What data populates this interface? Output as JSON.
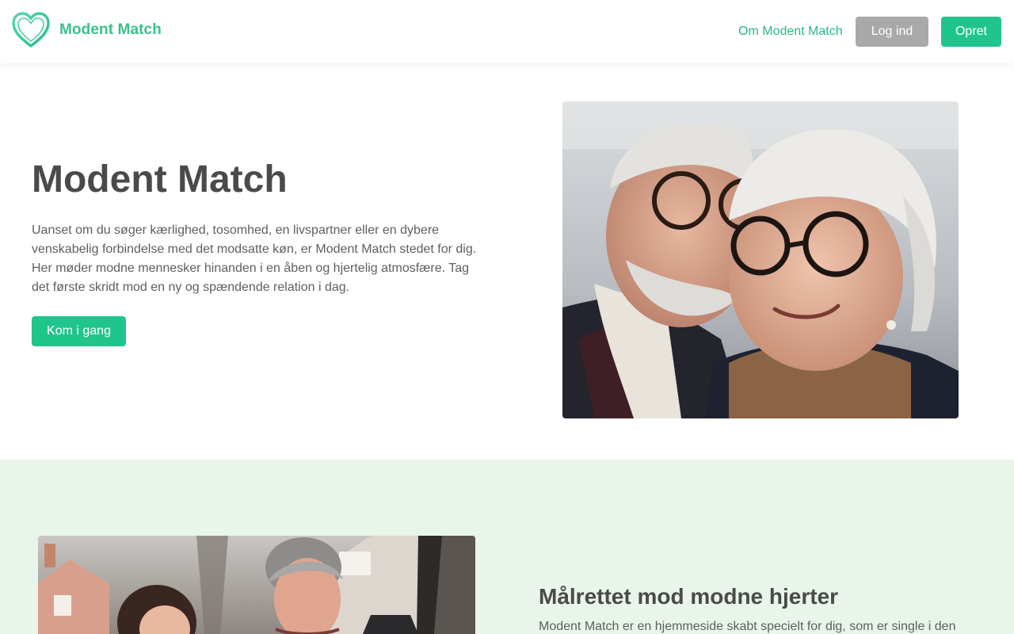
{
  "header": {
    "brand_name": "Modent Match",
    "nav_about": "Om Modent Match",
    "login_label": "Log ind",
    "signup_label": "Opret"
  },
  "hero": {
    "title": "Modent Match",
    "text": "Uanset om du søger kærlighed, tosomhed, en livspartner eller en dybere venskabelig forbindelse med det modsatte køn, er Modent Match stedet for dig. Her møder modne mennesker hinanden i en åben og hjertelig atmosfære. Tag det første skridt mod en ny og spændende relation i dag.",
    "cta_label": "Kom i gang"
  },
  "section2": {
    "title": "Målrettet mod modne hjerter",
    "text": "Modent Match er en hjemmeside skabt specielt for dig, som er single i den"
  },
  "colors": {
    "brand_green": "#20c58c",
    "logo_green": "#3cc08a",
    "login_gray": "#a9a9a9",
    "section_bg": "#e9f5ea",
    "heading": "#4a4a4a"
  },
  "icons": {
    "logo": "heart-outline-icon"
  }
}
